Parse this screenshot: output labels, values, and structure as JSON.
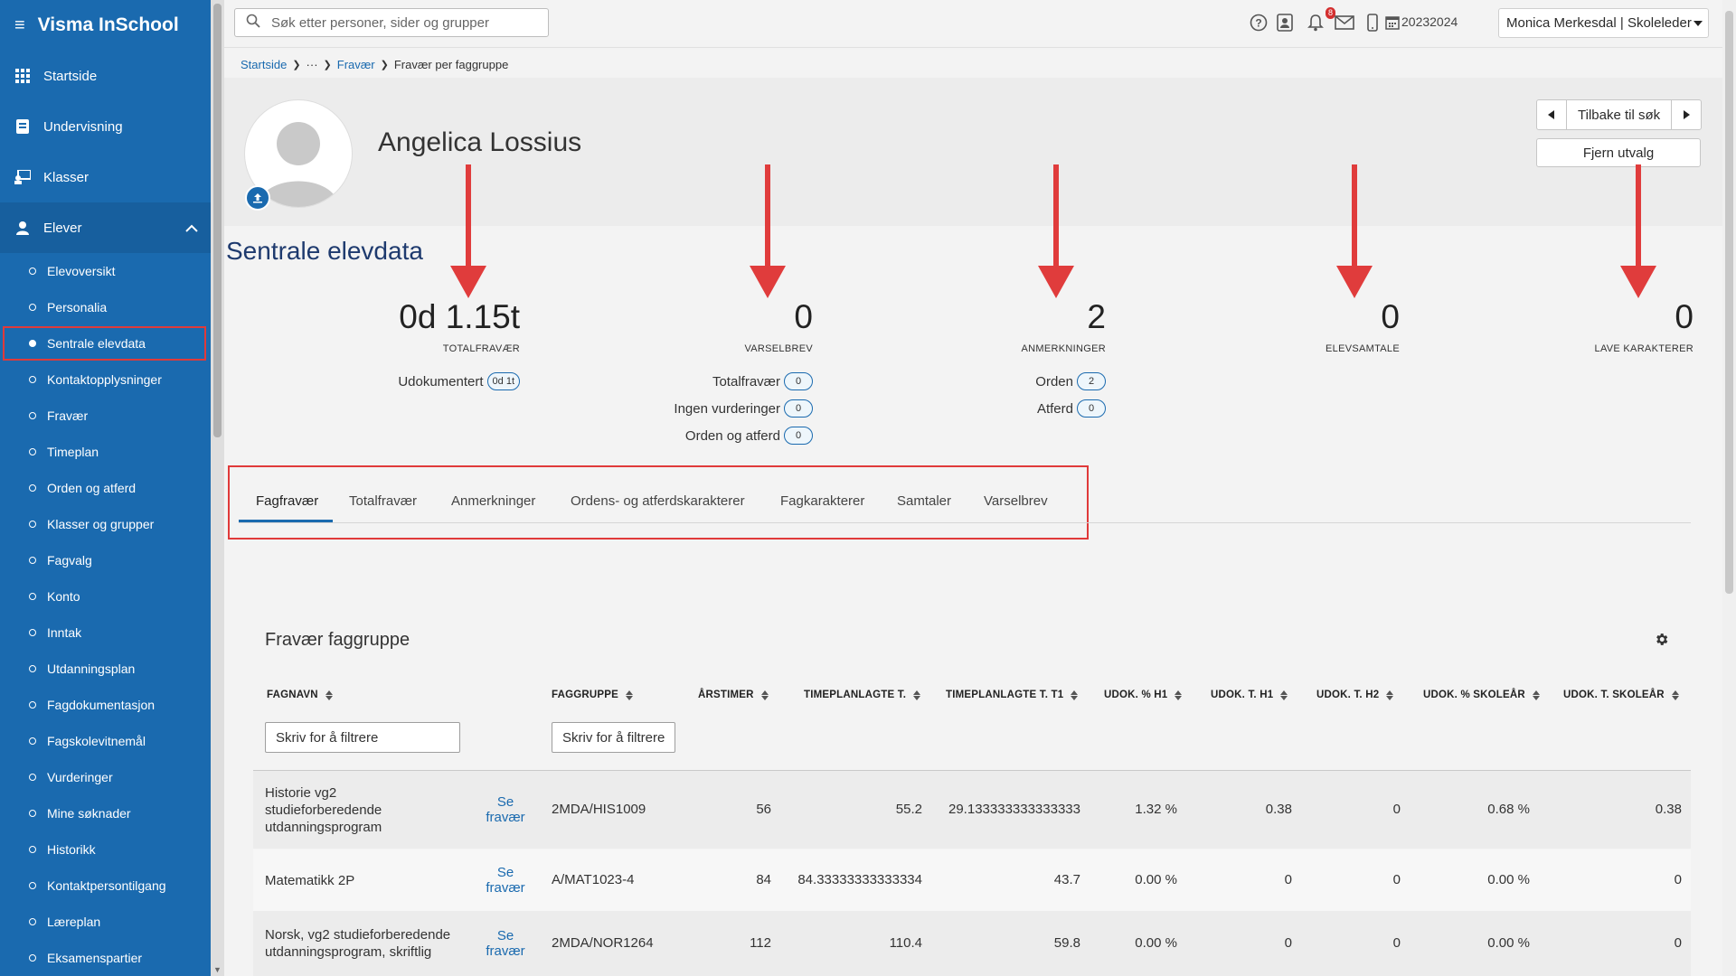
{
  "app": {
    "title": "Visma InSchool"
  },
  "sidebar": {
    "main": [
      {
        "label": "Startside"
      },
      {
        "label": "Undervisning"
      },
      {
        "label": "Klasser"
      },
      {
        "label": "Elever"
      }
    ],
    "sub": [
      {
        "label": "Elevoversikt"
      },
      {
        "label": "Personalia"
      },
      {
        "label": "Sentrale elevdata"
      },
      {
        "label": "Kontaktopplysninger"
      },
      {
        "label": "Fravær"
      },
      {
        "label": "Timeplan"
      },
      {
        "label": "Orden og atferd"
      },
      {
        "label": "Klasser og grupper"
      },
      {
        "label": "Fagvalg"
      },
      {
        "label": "Konto"
      },
      {
        "label": "Inntak"
      },
      {
        "label": "Utdanningsplan"
      },
      {
        "label": "Fagdokumentasjon"
      },
      {
        "label": "Fagskolevitnemål"
      },
      {
        "label": "Vurderinger"
      },
      {
        "label": "Mine søknader"
      },
      {
        "label": "Historikk"
      },
      {
        "label": "Kontaktpersontilgang"
      },
      {
        "label": "Læreplan"
      },
      {
        "label": "Eksamenspartier"
      }
    ]
  },
  "topbar": {
    "search_placeholder": "Søk etter personer, sider og grupper",
    "notification_count": "8",
    "school_year": "20232024",
    "user": "Monica Merkesdal | Skoleleder"
  },
  "breadcrumb": {
    "home": "Startside",
    "ellipsis": "···",
    "fravaer": "Fravær",
    "current": "Fravær per faggruppe"
  },
  "student": {
    "name": "Angelica Lossius"
  },
  "buttons": {
    "back_to_search": "Tilbake til søk",
    "clear_selection": "Fjern utvalg"
  },
  "section_title": "Sentrale elevdata",
  "stats": {
    "totalfravaer": {
      "value": "0d 1.15t",
      "label": "TOTALFRAVÆR",
      "udok_label": "Udokumentert",
      "udok_value": "0d 1t"
    },
    "varselbrev": {
      "value": "0",
      "label": "VARSELBREV",
      "rows": [
        {
          "label": "Totalfravær",
          "value": "0"
        },
        {
          "label": "Ingen vurderinger",
          "value": "0"
        },
        {
          "label": "Orden og atferd",
          "value": "0"
        }
      ]
    },
    "anmerkninger": {
      "value": "2",
      "label": "ANMERKNINGER",
      "rows": [
        {
          "label": "Orden",
          "value": "2"
        },
        {
          "label": "Atferd",
          "value": "0"
        }
      ]
    },
    "elevsamtale": {
      "value": "0",
      "label": "ELEVSAMTALE"
    },
    "lave_karakterer": {
      "value": "0",
      "label": "LAVE KARAKTERER"
    }
  },
  "tabs": [
    {
      "label": "Fagfravær",
      "active": true
    },
    {
      "label": "Totalfravær"
    },
    {
      "label": "Anmerkninger"
    },
    {
      "label": "Ordens- og atferdskarakterer"
    },
    {
      "label": "Fagkarakterer"
    },
    {
      "label": "Samtaler"
    },
    {
      "label": "Varselbrev"
    }
  ],
  "table": {
    "title": "Fravær faggruppe",
    "filter_placeholder": "Skriv for å filtrere",
    "columns": [
      "FAGNAVN",
      "FAGGRUPPE",
      "ÅRSTIMER",
      "TIMEPLANLAGTE T.",
      "TIMEPLANLAGTE T. T1",
      "UDOK. % H1",
      "UDOK. T. H1",
      "UDOK. T. H2",
      "UDOK. % SKOLEÅR",
      "UDOK. T. SKOLEÅR"
    ],
    "link_label_1": "Se",
    "link_label_2": "fravær",
    "rows": [
      {
        "fagnavn": [
          "Historie vg2",
          "studieforberedende",
          "utdanningsprogram"
        ],
        "faggruppe": "2MDA/HIS1009",
        "arstimer": "56",
        "tpl": "55.2",
        "tpl_t1": "29.133333333333333",
        "udok_pct_h1": "1.32 %",
        "udok_t_h1": "0.38",
        "udok_t_h2": "0",
        "udok_pct_sy": "0.68 %",
        "udok_t_sy": "0.38"
      },
      {
        "fagnavn": [
          "Matematikk 2P"
        ],
        "faggruppe": "A/MAT1023-4",
        "arstimer": "84",
        "tpl": "84.33333333333334",
        "tpl_t1": "43.7",
        "udok_pct_h1": "0.00 %",
        "udok_t_h1": "0",
        "udok_t_h2": "0",
        "udok_pct_sy": "0.00 %",
        "udok_t_sy": "0"
      },
      {
        "fagnavn": [
          "Norsk, vg2 studieforberedende",
          "utdanningsprogram, skriftlig"
        ],
        "faggruppe": "2MDA/NOR1264",
        "arstimer": "112",
        "tpl": "110.4",
        "tpl_t1": "59.8",
        "udok_pct_h1": "0.00 %",
        "udok_t_h1": "0",
        "udok_t_h2": "0",
        "udok_pct_sy": "0.00 %",
        "udok_t_sy": "0"
      }
    ]
  },
  "colors": {
    "brand": "#1a6aaf",
    "highlight": "#e03a3a"
  },
  "icons": [
    "menu-icon",
    "grid-icon",
    "book-icon",
    "chalkboard-icon",
    "student-icon",
    "search-icon",
    "help-icon",
    "contact-card-icon",
    "bell-icon",
    "mail-icon",
    "phone-icon",
    "calendar-icon",
    "upload-icon",
    "gear-icon",
    "sort-icon"
  ]
}
